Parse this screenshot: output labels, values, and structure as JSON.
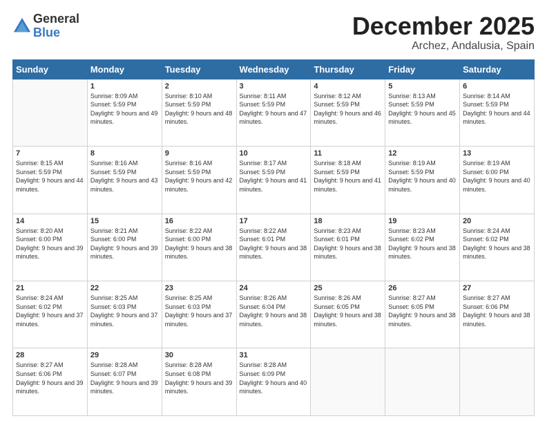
{
  "logo": {
    "general": "General",
    "blue": "Blue"
  },
  "title": "December 2025",
  "subtitle": "Archez, Andalusia, Spain",
  "days_header": [
    "Sunday",
    "Monday",
    "Tuesday",
    "Wednesday",
    "Thursday",
    "Friday",
    "Saturday"
  ],
  "weeks": [
    [
      {
        "day": "",
        "sunrise": "",
        "sunset": "",
        "daylight": ""
      },
      {
        "day": "1",
        "sunrise": "Sunrise: 8:09 AM",
        "sunset": "Sunset: 5:59 PM",
        "daylight": "Daylight: 9 hours and 49 minutes."
      },
      {
        "day": "2",
        "sunrise": "Sunrise: 8:10 AM",
        "sunset": "Sunset: 5:59 PM",
        "daylight": "Daylight: 9 hours and 48 minutes."
      },
      {
        "day": "3",
        "sunrise": "Sunrise: 8:11 AM",
        "sunset": "Sunset: 5:59 PM",
        "daylight": "Daylight: 9 hours and 47 minutes."
      },
      {
        "day": "4",
        "sunrise": "Sunrise: 8:12 AM",
        "sunset": "Sunset: 5:59 PM",
        "daylight": "Daylight: 9 hours and 46 minutes."
      },
      {
        "day": "5",
        "sunrise": "Sunrise: 8:13 AM",
        "sunset": "Sunset: 5:59 PM",
        "daylight": "Daylight: 9 hours and 45 minutes."
      },
      {
        "day": "6",
        "sunrise": "Sunrise: 8:14 AM",
        "sunset": "Sunset: 5:59 PM",
        "daylight": "Daylight: 9 hours and 44 minutes."
      }
    ],
    [
      {
        "day": "7",
        "sunrise": "Sunrise: 8:15 AM",
        "sunset": "Sunset: 5:59 PM",
        "daylight": "Daylight: 9 hours and 44 minutes."
      },
      {
        "day": "8",
        "sunrise": "Sunrise: 8:16 AM",
        "sunset": "Sunset: 5:59 PM",
        "daylight": "Daylight: 9 hours and 43 minutes."
      },
      {
        "day": "9",
        "sunrise": "Sunrise: 8:16 AM",
        "sunset": "Sunset: 5:59 PM",
        "daylight": "Daylight: 9 hours and 42 minutes."
      },
      {
        "day": "10",
        "sunrise": "Sunrise: 8:17 AM",
        "sunset": "Sunset: 5:59 PM",
        "daylight": "Daylight: 9 hours and 41 minutes."
      },
      {
        "day": "11",
        "sunrise": "Sunrise: 8:18 AM",
        "sunset": "Sunset: 5:59 PM",
        "daylight": "Daylight: 9 hours and 41 minutes."
      },
      {
        "day": "12",
        "sunrise": "Sunrise: 8:19 AM",
        "sunset": "Sunset: 5:59 PM",
        "daylight": "Daylight: 9 hours and 40 minutes."
      },
      {
        "day": "13",
        "sunrise": "Sunrise: 8:19 AM",
        "sunset": "Sunset: 6:00 PM",
        "daylight": "Daylight: 9 hours and 40 minutes."
      }
    ],
    [
      {
        "day": "14",
        "sunrise": "Sunrise: 8:20 AM",
        "sunset": "Sunset: 6:00 PM",
        "daylight": "Daylight: 9 hours and 39 minutes."
      },
      {
        "day": "15",
        "sunrise": "Sunrise: 8:21 AM",
        "sunset": "Sunset: 6:00 PM",
        "daylight": "Daylight: 9 hours and 39 minutes."
      },
      {
        "day": "16",
        "sunrise": "Sunrise: 8:22 AM",
        "sunset": "Sunset: 6:00 PM",
        "daylight": "Daylight: 9 hours and 38 minutes."
      },
      {
        "day": "17",
        "sunrise": "Sunrise: 8:22 AM",
        "sunset": "Sunset: 6:01 PM",
        "daylight": "Daylight: 9 hours and 38 minutes."
      },
      {
        "day": "18",
        "sunrise": "Sunrise: 8:23 AM",
        "sunset": "Sunset: 6:01 PM",
        "daylight": "Daylight: 9 hours and 38 minutes."
      },
      {
        "day": "19",
        "sunrise": "Sunrise: 8:23 AM",
        "sunset": "Sunset: 6:02 PM",
        "daylight": "Daylight: 9 hours and 38 minutes."
      },
      {
        "day": "20",
        "sunrise": "Sunrise: 8:24 AM",
        "sunset": "Sunset: 6:02 PM",
        "daylight": "Daylight: 9 hours and 38 minutes."
      }
    ],
    [
      {
        "day": "21",
        "sunrise": "Sunrise: 8:24 AM",
        "sunset": "Sunset: 6:02 PM",
        "daylight": "Daylight: 9 hours and 37 minutes."
      },
      {
        "day": "22",
        "sunrise": "Sunrise: 8:25 AM",
        "sunset": "Sunset: 6:03 PM",
        "daylight": "Daylight: 9 hours and 37 minutes."
      },
      {
        "day": "23",
        "sunrise": "Sunrise: 8:25 AM",
        "sunset": "Sunset: 6:03 PM",
        "daylight": "Daylight: 9 hours and 37 minutes."
      },
      {
        "day": "24",
        "sunrise": "Sunrise: 8:26 AM",
        "sunset": "Sunset: 6:04 PM",
        "daylight": "Daylight: 9 hours and 38 minutes."
      },
      {
        "day": "25",
        "sunrise": "Sunrise: 8:26 AM",
        "sunset": "Sunset: 6:05 PM",
        "daylight": "Daylight: 9 hours and 38 minutes."
      },
      {
        "day": "26",
        "sunrise": "Sunrise: 8:27 AM",
        "sunset": "Sunset: 6:05 PM",
        "daylight": "Daylight: 9 hours and 38 minutes."
      },
      {
        "day": "27",
        "sunrise": "Sunrise: 8:27 AM",
        "sunset": "Sunset: 6:06 PM",
        "daylight": "Daylight: 9 hours and 38 minutes."
      }
    ],
    [
      {
        "day": "28",
        "sunrise": "Sunrise: 8:27 AM",
        "sunset": "Sunset: 6:06 PM",
        "daylight": "Daylight: 9 hours and 39 minutes."
      },
      {
        "day": "29",
        "sunrise": "Sunrise: 8:28 AM",
        "sunset": "Sunset: 6:07 PM",
        "daylight": "Daylight: 9 hours and 39 minutes."
      },
      {
        "day": "30",
        "sunrise": "Sunrise: 8:28 AM",
        "sunset": "Sunset: 6:08 PM",
        "daylight": "Daylight: 9 hours and 39 minutes."
      },
      {
        "day": "31",
        "sunrise": "Sunrise: 8:28 AM",
        "sunset": "Sunset: 6:09 PM",
        "daylight": "Daylight: 9 hours and 40 minutes."
      },
      {
        "day": "",
        "sunrise": "",
        "sunset": "",
        "daylight": ""
      },
      {
        "day": "",
        "sunrise": "",
        "sunset": "",
        "daylight": ""
      },
      {
        "day": "",
        "sunrise": "",
        "sunset": "",
        "daylight": ""
      }
    ]
  ]
}
